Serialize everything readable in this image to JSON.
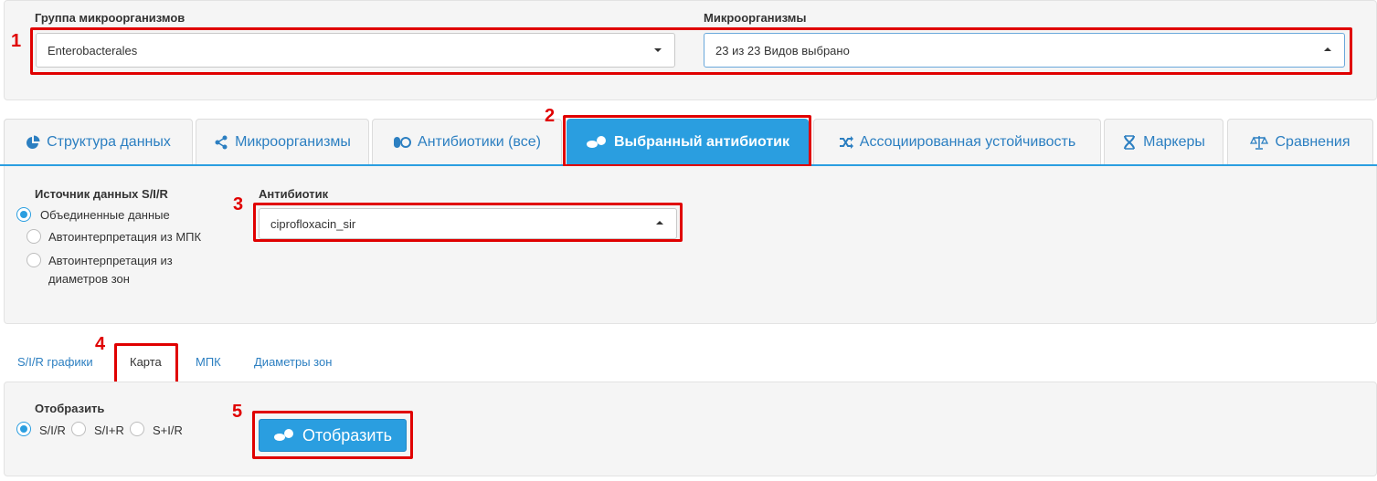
{
  "filters": {
    "group_label": "Группа микроорганизмов",
    "group_value": "Enterobacterales",
    "micro_label": "Микроорганизмы",
    "micro_value": "23 из 23 Видов выбрано"
  },
  "tabs": [
    {
      "label": "Структура данных",
      "icon": "pie-chart-icon"
    },
    {
      "label": "Микроорганизмы",
      "icon": "share-nodes-icon"
    },
    {
      "label": "Антибиотики (все)",
      "icon": "pills-icon"
    },
    {
      "label": "Выбранный антибиотик",
      "icon": "pills-icon",
      "active": true
    },
    {
      "label": "Ассоциированная устойчивость",
      "icon": "shuffle-icon"
    },
    {
      "label": "Маркеры",
      "icon": "dna-icon"
    },
    {
      "label": "Сравнения",
      "icon": "balance-scale-icon"
    }
  ],
  "source": {
    "label": "Источник данных S/I/R",
    "options": [
      "Объединенные данные",
      "Автоинтерпретация из МПК",
      "Автоинтерпретация из",
      "диаметров зон"
    ],
    "selected": "Объединенные данные"
  },
  "antibiotic": {
    "label": "Антибиотик",
    "value": "ciprofloxacin_sir"
  },
  "subtabs": [
    {
      "label": "S/I/R графики"
    },
    {
      "label": "Карта",
      "active": true
    },
    {
      "label": "МПК"
    },
    {
      "label": "Диаметры зон"
    }
  ],
  "display": {
    "label": "Отобразить",
    "options": [
      "S/I/R",
      "S/I+R",
      "S+I/R"
    ],
    "selected": "S/I/R",
    "button_label": "Отобразить"
  },
  "annotations": [
    "1",
    "2",
    "3",
    "4",
    "5"
  ],
  "colors": {
    "accent": "#2a9ee0",
    "highlight": "#e00000",
    "panel": "#f5f5f5"
  }
}
